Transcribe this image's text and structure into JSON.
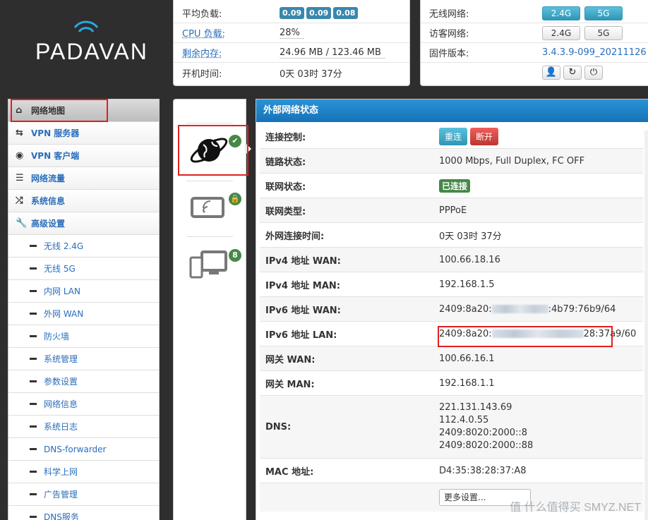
{
  "logo": {
    "text": "PADAVAN"
  },
  "system": {
    "load_label": "平均负载:",
    "load_values": [
      "0.09",
      "0.09",
      "0.08"
    ],
    "cpu_label": "CPU 负载:",
    "cpu_value": "28%",
    "mem_label": "剩余内存:",
    "mem_value": "24.96 MB / 123.46 MB",
    "uptime_label": "开机时间:",
    "uptime_value": "0天 03时 37分"
  },
  "network": {
    "wireless_label": "无线网络:",
    "guest_label": "访客网络:",
    "firmware_label": "固件版本:",
    "band_24": "2.4G",
    "band_5": "5G",
    "firmware_value": "3.4.3.9-099_20211126",
    "icons": [
      "user-icon",
      "refresh-icon",
      "power-icon"
    ]
  },
  "sidebar": {
    "items": [
      {
        "label": "网络地图",
        "icon": "home-icon"
      },
      {
        "label": "VPN 服务器",
        "icon": "retweet-icon"
      },
      {
        "label": "VPN 客户端",
        "icon": "globe-icon"
      },
      {
        "label": "网络流量",
        "icon": "list-icon"
      },
      {
        "label": "系统信息",
        "icon": "random-icon"
      },
      {
        "label": "高级设置",
        "icon": "wrench-icon"
      }
    ],
    "subitems": [
      "无线 2.4G",
      "无线 5G",
      "内网 LAN",
      "外网 WAN",
      "防火墙",
      "系统管理",
      "参数设置",
      "网络信息",
      "系统日志",
      "DNS-forwarder",
      "科学上网",
      "广告管理",
      "DNS服务"
    ]
  },
  "middle": {
    "client_count": "8"
  },
  "wan": {
    "title": "外部网络状态",
    "rows": {
      "control_label": "连接控制:",
      "reconnect": "重连",
      "disconnect": "断开",
      "link_label": "链路状态:",
      "link_value": "1000 Mbps, Full Duplex, FC OFF",
      "inet_label": "联网状态:",
      "inet_value": "已连接",
      "type_label": "联网类型:",
      "type_value": "PPPoE",
      "time_label": "外网连接时间:",
      "time_value": "0天 03时 37分",
      "ipv4wan_label": "IPv4 地址 WAN:",
      "ipv4wan_value": "100.66.18.16",
      "ipv4man_label": "IPv4 地址 MAN:",
      "ipv4man_value": "192.168.1.5",
      "ipv6wan_label": "IPv6 地址 WAN:",
      "ipv6wan_prefix": "2409:8a20:",
      "ipv6wan_suffix": ":4b79:76b9/64",
      "ipv6lan_label": "IPv6 地址 LAN:",
      "ipv6lan_prefix": "2409:8a20:",
      "ipv6lan_suffix": "28:37a9/60",
      "gwwan_label": "网关 WAN:",
      "gwwan_value": "100.66.16.1",
      "gwman_label": "网关 MAN:",
      "gwman_value": "192.168.1.1",
      "dns_label": "DNS:",
      "dns_values": [
        "221.131.143.69",
        "112.4.0.55",
        "2409:8020:2000::8",
        "2409:8020:2000::88"
      ],
      "mac_label": "MAC 地址:",
      "mac_value": "D4:35:38:28:37:A8",
      "more_select": "更多设置..."
    }
  },
  "watermark": "值 什么值得买 SMYZ.NET",
  "colors": {
    "accent": "#2a93d5",
    "success": "#468847",
    "danger": "#bd362f",
    "highlight": "#e02020"
  }
}
